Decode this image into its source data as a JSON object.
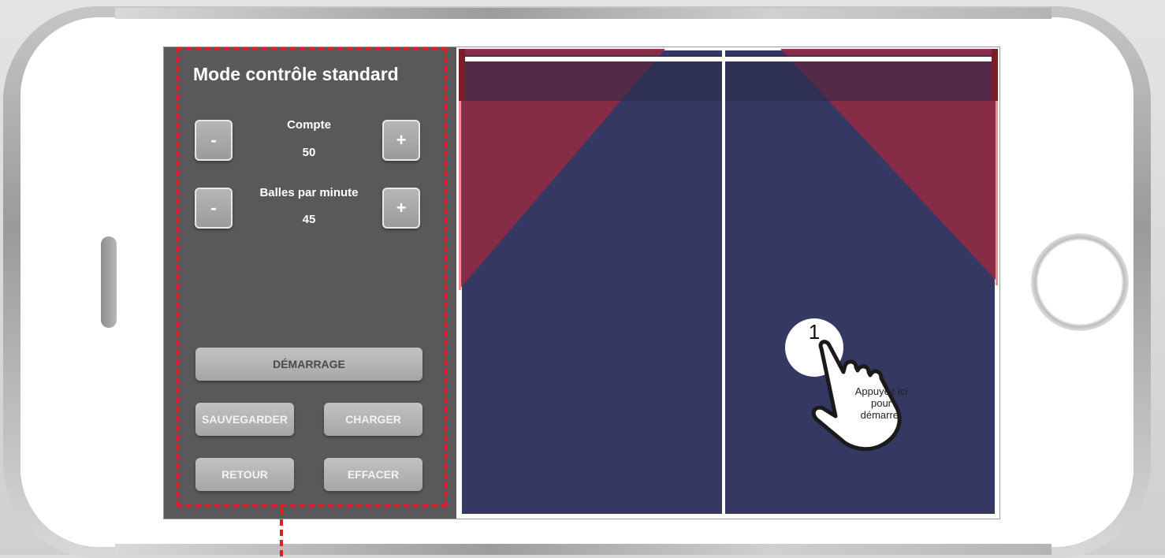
{
  "panel": {
    "title": "Mode contrôle standard",
    "count": {
      "label": "Compte",
      "value": "50",
      "minus": "-",
      "plus": "+"
    },
    "balls_per_minute": {
      "label": "Balles par minute",
      "value": "45",
      "minus": "-",
      "plus": "+"
    },
    "start_label": "DÉMARRAGE",
    "save_label": "SAUVEGARDER",
    "load_label": "CHARGER",
    "back_label": "RETOUR",
    "clear_label": "EFFACER"
  },
  "hint": {
    "step_number": "1",
    "text": "Appuyez ici pour démarrer"
  },
  "colors": {
    "panel_bg": "#59595b",
    "table_blue": "#343863",
    "zone_red": "#8b2b45",
    "frame_dash": "#d8202a"
  },
  "icons": {
    "hand": "tap-hand-icon",
    "side_button": "volume-button",
    "home_button": "home-button"
  }
}
